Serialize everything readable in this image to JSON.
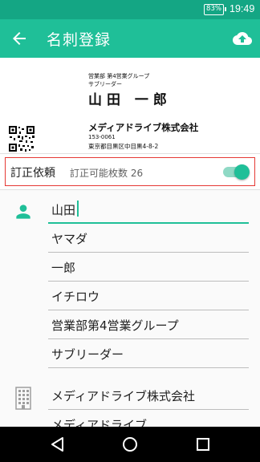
{
  "status_bar": {
    "battery": "83%",
    "time": "19:49"
  },
  "app_bar": {
    "title": "名刺登録",
    "back_icon": "arrow-back-icon",
    "upload_icon": "cloud-upload-icon"
  },
  "card": {
    "department": "営業部 第4営業グループ",
    "role": "サブリーダー",
    "name": "山田 一郎",
    "company": "メディアドライブ株式会社",
    "zip": "153-0061",
    "address": "東京都目黒区中目黒4-8-2"
  },
  "correction": {
    "label": "訂正依頼",
    "count_text": "訂正可能枚数 26",
    "enabled": true
  },
  "person_fields": [
    "山田",
    "ヤマダ",
    "一郎",
    "イチロウ",
    "営業部第4営業グループ",
    "サブリーダー"
  ],
  "company_fields": [
    "メディアドライブ株式会社",
    "メディアドライブ"
  ],
  "colors": {
    "primary": "#1fbf98",
    "primary_dark": "#14a684",
    "highlight_border": "#e53935"
  }
}
